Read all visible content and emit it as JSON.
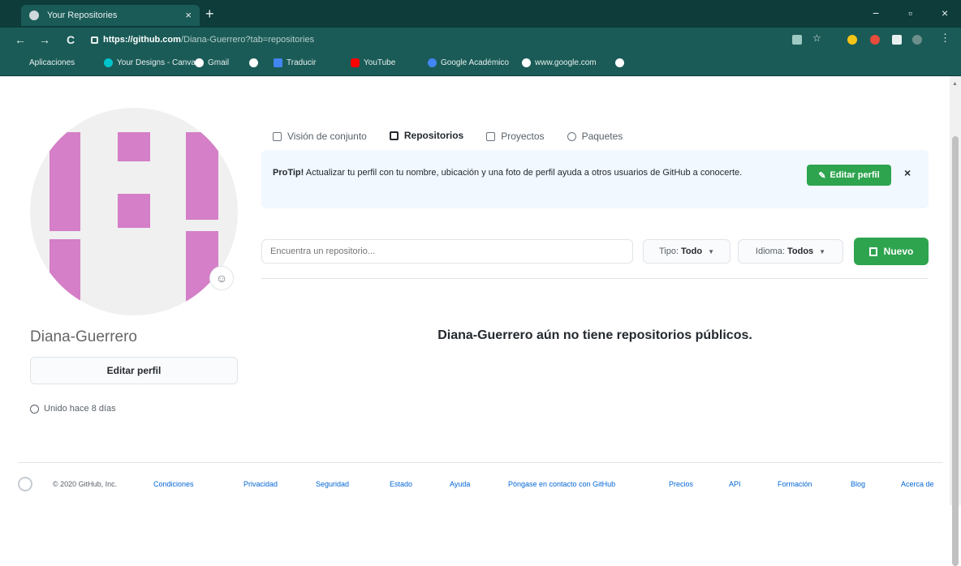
{
  "browser": {
    "tab_title": "Your Repositories",
    "tab_close": "×",
    "new_tab": "+",
    "url_host": "https://github.com",
    "url_path": "/Diana-Guerrero?tab=repositories",
    "window_controls": [
      "−",
      "▫",
      "×"
    ],
    "nav": [
      "←",
      "→",
      "C"
    ],
    "bookmarks": [
      {
        "label": "Aplicaciones",
        "color": "#e8f0ef"
      },
      {
        "label": "Your Designs - Canva",
        "color": "#00c4cc"
      },
      {
        "label": "Gmail",
        "color": "#ffffff"
      },
      {
        "label": "",
        "color": "#ffffff"
      },
      {
        "label": "Traducir",
        "color": "#4285f4"
      },
      {
        "label": "YouTube",
        "color": "#ff0000"
      },
      {
        "label": "Google Académico",
        "color": "#4285f4"
      },
      {
        "label": "www.google.com",
        "color": "#ffffff"
      },
      {
        "label": "",
        "color": "#ffffff"
      }
    ]
  },
  "profile": {
    "username": "Diana-Guerrero",
    "edit_button": "Editar perfil",
    "joined": "Unido hace 8 días",
    "emoji_icon": "smiley-icon"
  },
  "tabs": [
    {
      "label": "Visión de conjunto",
      "active": false
    },
    {
      "label": "Repositorios",
      "active": true
    },
    {
      "label": "Proyectos",
      "active": false
    },
    {
      "label": "Paquetes",
      "active": false
    }
  ],
  "protip": {
    "lead": "ProTip!",
    "text": "Actualizar tu perfil con tu nombre, ubicación y una foto de perfil ayuda a otros usuarios de GitHub a conocerte.",
    "button": "Editar perfil",
    "close": "×"
  },
  "filters": {
    "search_placeholder": "Encuentra un repositorio...",
    "type_label": "Tipo:",
    "type_value": "Todo",
    "language_label": "Idioma:",
    "language_value": "Todos",
    "new_button": "Nuevo"
  },
  "empty_message": "Diana-Guerrero aún no tiene repositorios públicos.",
  "footer": {
    "copyright": "© 2020 GitHub, Inc.",
    "links": [
      "Condiciones",
      "Privacidad",
      "Seguridad",
      "Estado",
      "Ayuda",
      "Póngase en contacto con GitHub",
      "Precios",
      "API",
      "Formación",
      "Blog",
      "Acerca de"
    ]
  },
  "colors": {
    "accent_green": "#2ea44f",
    "identicon": "#d47fc7",
    "chrome": "#1a5b57"
  }
}
